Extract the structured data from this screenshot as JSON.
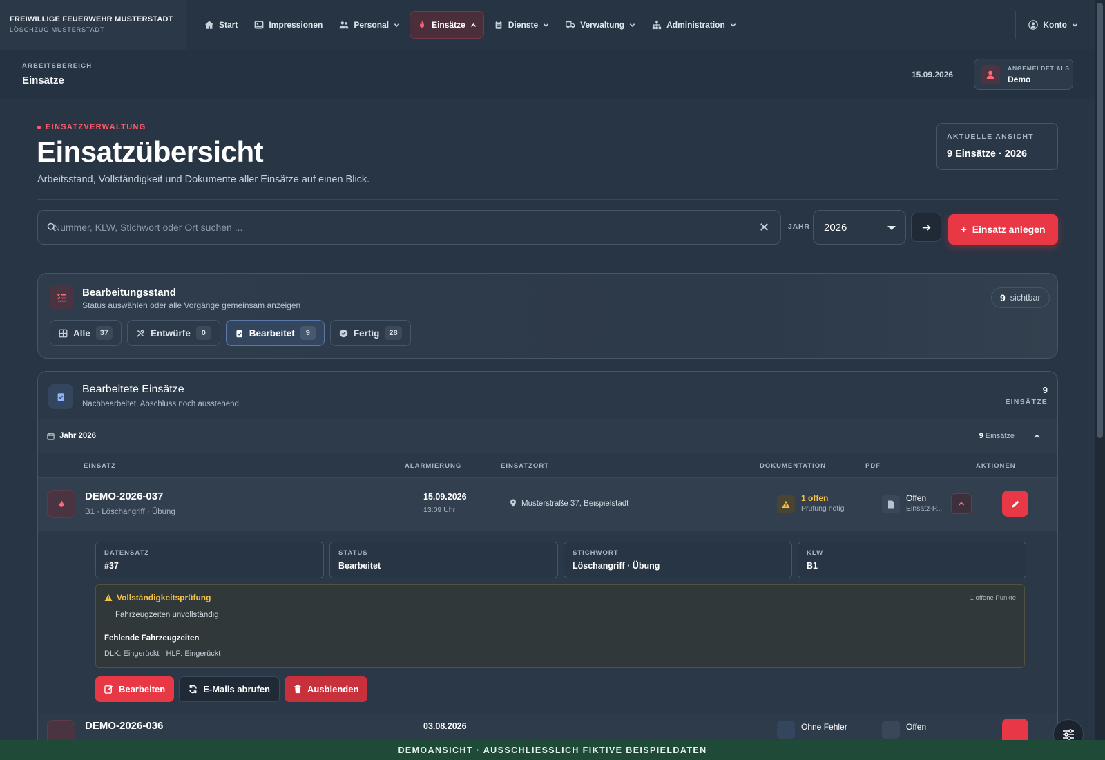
{
  "brand": {
    "title": "FREIWILLIGE FEUERWEHR MUSTERSTADT",
    "sub": "LÖSCHZUG MUSTERSTADT"
  },
  "nav": {
    "start": "Start",
    "impressionen": "Impressionen",
    "personal": "Personal",
    "einsaetze": "Einsätze",
    "dienste": "Dienste",
    "verwaltung": "Verwaltung",
    "administration": "Administration",
    "konto": "Konto"
  },
  "workspace": {
    "kicker": "ARBEITSBEREICH",
    "title": "Einsätze",
    "date": "15.09.2026",
    "user_kicker": "ANGEMELDET ALS",
    "user_name": "Demo"
  },
  "header": {
    "kicker": "EINSATZVERWALTUNG",
    "title": "Einsatzübersicht",
    "subtitle": "Arbeitsstand, Vollständigkeit und Dokumente aller Einsätze auf einen Blick.",
    "view_kicker": "AKTUELLE ANSICHT",
    "view_value": "9 Einsätze · 2026"
  },
  "search": {
    "placeholder": "Nummer, KLW, Stichwort oder Ort suchen ...",
    "year_label": "JAHR",
    "year_value": "2026",
    "new_button": "Einsatz anlegen"
  },
  "status": {
    "title": "Bearbeitungsstand",
    "subtitle": "Status auswählen oder alle Vorgänge gemeinsam anzeigen",
    "visible_count": "9",
    "visible_label": "sichtbar",
    "filters": [
      {
        "label": "Alle",
        "count": "37",
        "icon": "grid-icon"
      },
      {
        "label": "Entwürfe",
        "count": "0",
        "icon": "tools-icon"
      },
      {
        "label": "Bearbeitet",
        "count": "9",
        "icon": "clipboard-check-icon"
      },
      {
        "label": "Fertig",
        "count": "28",
        "icon": "check-circle-icon"
      }
    ]
  },
  "list": {
    "title": "Bearbeitete Einsätze",
    "subtitle": "Nachbearbeitet, Abschluss noch ausstehend",
    "count": "9",
    "count_label": "EINSÄTZE",
    "year_label": "Jahr 2026",
    "year_count": "9",
    "year_count_label": "Einsätze",
    "columns": {
      "einsatz": "EINSATZ",
      "alarmierung": "ALARMIERUNG",
      "einsatzort": "EINSATZORT",
      "dokumentation": "DOKUMENTATION",
      "pdf": "PDF",
      "aktionen": "AKTIONEN"
    },
    "row1": {
      "id": "DEMO-2026-037",
      "meta": "B1 · Löschangriff · Übung",
      "date": "15.09.2026",
      "time": "13:09 Uhr",
      "location": "Musterstraße 37, Beispielstadt",
      "doc_status": "1 offen",
      "doc_sub": "Prüfung nötig",
      "pdf_status": "Offen",
      "pdf_sub": "Einsatz-P..."
    },
    "detail": {
      "fields": [
        {
          "key": "DATENSATZ",
          "value": "#37"
        },
        {
          "key": "STATUS",
          "value": "Bearbeitet"
        },
        {
          "key": "STICHWORT",
          "value": "Löschangriff · Übung"
        },
        {
          "key": "KLW",
          "value": "B1"
        }
      ],
      "check_title": "Vollständigkeitsprüfung",
      "check_count": "1 offene Punkte",
      "check_item": "Fahrzeugzeiten unvollständig",
      "missing_title": "Fehlende Fahrzeugzeiten",
      "missing": [
        "DLK: Eingerückt",
        "HLF: Eingerückt"
      ],
      "btn_edit": "Bearbeiten",
      "btn_mail": "E-Mails abrufen",
      "btn_hide": "Ausblenden"
    },
    "row2": {
      "id": "DEMO-2026-036",
      "date": "03.08.2026",
      "doc_status": "Ohne Fehler",
      "pdf_status": "Offen"
    }
  },
  "demo_banner": "DEMOANSICHT · AUSSCHLIESSLICH FIKTIVE BEISPIELDATEN",
  "colors": {
    "accent": "#e83845",
    "warning": "#f5c244",
    "background": "#283544",
    "banner": "#1e4a37"
  }
}
